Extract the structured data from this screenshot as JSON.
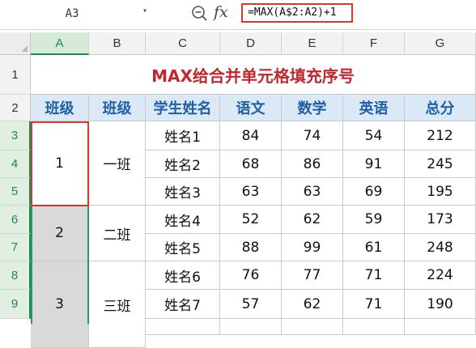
{
  "formula_bar": {
    "name_box": "A3",
    "zoom_icon": "zoom-icon",
    "fx_label": "fx",
    "formula": "=MAX(A$2:A2)+1"
  },
  "columns": [
    "A",
    "B",
    "C",
    "D",
    "E",
    "F",
    "G"
  ],
  "rows": [
    "1",
    "2",
    "3",
    "4",
    "5",
    "6",
    "7",
    "8",
    "9"
  ],
  "sheet": {
    "title": "MAX给合并单元格填充序号",
    "headers": [
      "班级",
      "班级",
      "学生姓名",
      "语文",
      "数学",
      "英语",
      "总分"
    ],
    "groups": [
      {
        "seq": "1",
        "class": "一班"
      },
      {
        "seq": "2",
        "class": "二班"
      },
      {
        "seq": "3",
        "class": "三班"
      }
    ],
    "students": [
      {
        "name": "姓名1",
        "chinese": "84",
        "math": "74",
        "english": "54",
        "total": "212"
      },
      {
        "name": "姓名2",
        "chinese": "68",
        "math": "86",
        "english": "91",
        "total": "245"
      },
      {
        "name": "姓名3",
        "chinese": "63",
        "math": "63",
        "english": "69",
        "total": "195"
      },
      {
        "name": "姓名4",
        "chinese": "52",
        "math": "62",
        "english": "59",
        "total": "173"
      },
      {
        "name": "姓名5",
        "chinese": "88",
        "math": "99",
        "english": "61",
        "total": "248"
      },
      {
        "name": "姓名6",
        "chinese": "76",
        "math": "77",
        "english": "71",
        "total": "224"
      },
      {
        "name": "姓名7",
        "chinese": "57",
        "math": "62",
        "english": "71",
        "total": "190"
      }
    ]
  },
  "colors": {
    "title_red": "#c0282d",
    "header_blue": "#1f5fa8",
    "header_bg": "#dbe9f7",
    "selection_green": "#1e8a4f",
    "active_cell_red": "#d23b2e"
  }
}
